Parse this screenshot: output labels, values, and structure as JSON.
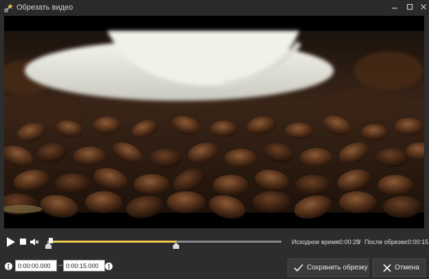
{
  "window": {
    "title": "Обрезать видео",
    "icons": [
      "scissors-star-icon",
      "minimize-icon",
      "maximize-icon",
      "close-icon"
    ]
  },
  "player": {
    "icons": [
      "play-icon",
      "stop-icon",
      "mute-icon"
    ],
    "timeline": {
      "trim_start_fraction": 0.0,
      "trim_end_fraction": 0.54,
      "playhead_fraction": 0.0
    }
  },
  "times": {
    "source_label": "Исходное время:",
    "source_value": "0:00:28",
    "separator": "/",
    "after_label": "После обрезки:",
    "after_value": "0:00:15"
  },
  "trim": {
    "start_value": "0:00:00.000",
    "end_value": "0:00:15.000",
    "dash": "–",
    "start_marker_glyph": "[",
    "end_marker_glyph": "]"
  },
  "buttons": {
    "save_label": "Сохранить обрезку",
    "cancel_label": "Отмена"
  },
  "colors": {
    "accent": "#f2c94c",
    "background": "#2d2d2d"
  }
}
